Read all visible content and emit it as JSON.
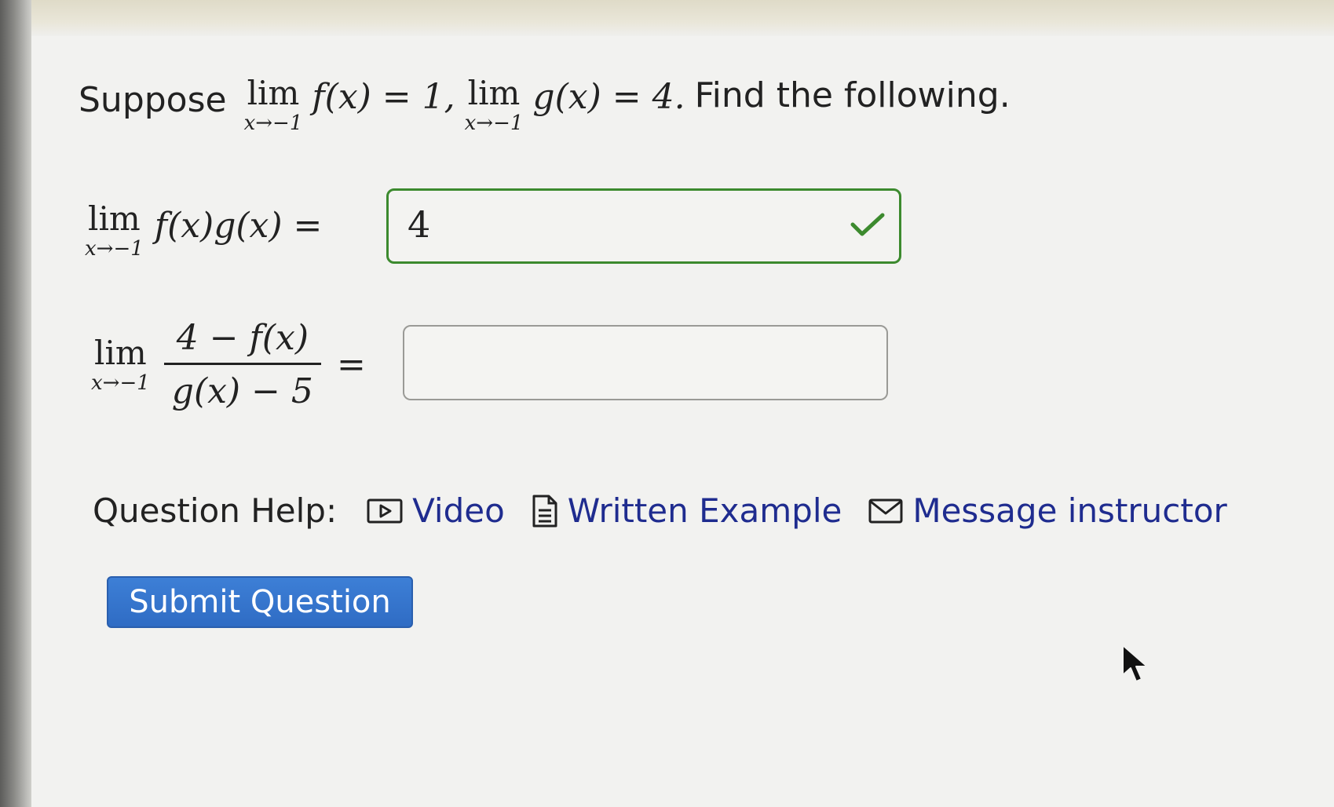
{
  "intro": {
    "prefix": "Suppose",
    "lim": "lim",
    "sub": "x→−1",
    "f_expr": "f(x) = 1,",
    "g_expr": "g(x) = 4.",
    "suffix": "Find the following."
  },
  "q1": {
    "lim": "lim",
    "sub": "x→−1",
    "expr": "f(x)g(x) =",
    "answer": "4",
    "status": "correct"
  },
  "q2": {
    "lim": "lim",
    "sub": "x→−1",
    "numerator": "4 − f(x)",
    "denominator": "g(x) − 5",
    "eq": "=",
    "answer": ""
  },
  "help": {
    "label": "Question Help:",
    "video": "Video",
    "written": "Written Example",
    "message": "Message instructor"
  },
  "submit_label": "Submit Question",
  "colors": {
    "correct": "#3c8a2e",
    "link": "#1f2c8f",
    "submit": "#2f6cc4"
  }
}
